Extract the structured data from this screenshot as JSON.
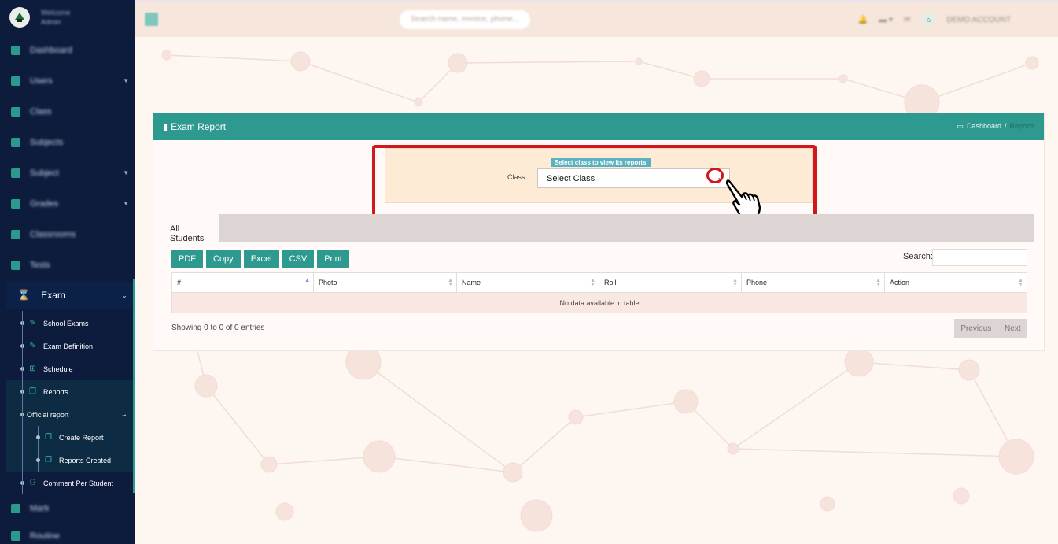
{
  "sidebar": {
    "user_line1": "Welcome",
    "user_line2": "Admin",
    "items": [
      {
        "label": "Dashboard"
      },
      {
        "label": "Users"
      },
      {
        "label": "Class"
      },
      {
        "label": "Subjects"
      },
      {
        "label": "Subject"
      },
      {
        "label": "Grades"
      },
      {
        "label": "Classrooms"
      },
      {
        "label": "Tests"
      }
    ],
    "exam": {
      "label": "Exam"
    },
    "exam_items": [
      {
        "label": "School Exams",
        "icon": "pencil-icon"
      },
      {
        "label": "Exam Definition",
        "icon": "pencil-icon"
      },
      {
        "label": "Schedule",
        "icon": "sitemap-icon"
      },
      {
        "label": "Reports",
        "icon": "copy-icon"
      },
      {
        "label": "Official report",
        "icon": ""
      },
      {
        "label": "Create Report",
        "icon": "copy-icon"
      },
      {
        "label": "Reports Created",
        "icon": "copy-icon"
      },
      {
        "label": "Comment Per Student",
        "icon": "users-icon"
      }
    ],
    "after_items": [
      {
        "label": "Mark"
      },
      {
        "label": "Routine"
      }
    ]
  },
  "topbar": {
    "search_placeholder": "Search name, invoice, phone...",
    "account": "DEMO ACCOUNT"
  },
  "card": {
    "title": "Exam Report",
    "breadcrumb": {
      "home": "Dashboard",
      "sep": "/",
      "current": "Reports"
    },
    "select_hint": "Select class to view its reports",
    "class_label": "Class",
    "class_value": "Select Class",
    "tab_label": "All Students",
    "buttons": [
      "PDF",
      "Copy",
      "Excel",
      "CSV",
      "Print"
    ],
    "search_label": "Search:",
    "columns": [
      "#",
      "Photo",
      "Name",
      "Roll",
      "Phone",
      "Action"
    ],
    "empty_text": "No data available in table",
    "showing_text": "Showing 0 to 0 of 0 entries",
    "prev_label": "Previous",
    "next_label": "Next"
  },
  "colors": {
    "accent": "#2e9a8f",
    "sidebar": "#0d1b3d",
    "highlight": "#d0181c"
  }
}
